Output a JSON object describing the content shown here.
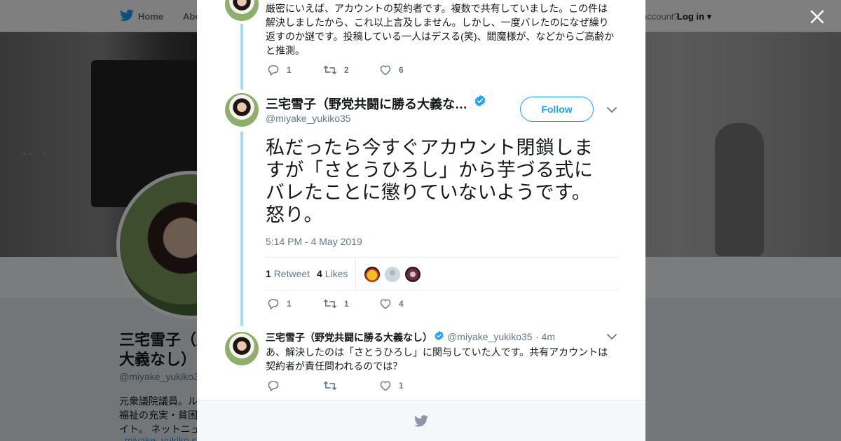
{
  "topbar": {
    "home_label": "Home",
    "about_label": "Abo",
    "account_label": "account?",
    "login_label": "Log in ▾"
  },
  "profile_bg": {
    "name_line1": "三宅雪子（野",
    "name_line2": "大義なし）",
    "handle": "@miyake_yukiko3",
    "bio_line1": "元衆議院議員。ル",
    "bio_line2": "福祉の充実・貧困",
    "bio_line3": "イト。 ネットニュ",
    "bio_link": "_miyake_yukiko s"
  },
  "tweets": [
    {
      "text": "厳密にいえば、アカウントの契約者です。複数で共有していました。この件は解決しましたから、これ以上言及しません。しかし、一度バレたのになぜ繰り返すのか謎です。投稿している一人はデスる(笑)、閻魔様が、などからご高齢かと推測。",
      "replies": "1",
      "retweets": "2",
      "likes": "6"
    },
    {
      "name": "三宅雪子（野党共闘に勝る大義な…",
      "handle": "@miyake_yukiko35",
      "follow_label": "Follow",
      "text": "私だったら今すぐアカウント閉鎖しますが「さとうひろし」から芋づる式にバレたことに懲りていないようです。怒り。",
      "timestamp": "5:14 PM - 4 May 2019",
      "retweet_count": "1",
      "retweet_label": "Retweet",
      "likes_count": "4",
      "likes_label": "Likes",
      "replies": "1",
      "retweets": "1",
      "likes": "4"
    },
    {
      "name": "三宅雪子（野党共闘に勝る大義なし）",
      "handle": "@miyake_yukiko35",
      "time": "· 4m",
      "text": "あ、解決したのは「さとうひろし」に関与していた人です。共有アカウントは契約者が責任問われるのでは？",
      "replies": "",
      "retweets": "",
      "likes": "1"
    }
  ],
  "colors": {
    "accent": "#1da1f2",
    "thread_line": "#a6d8f8",
    "muted": "#657786"
  }
}
